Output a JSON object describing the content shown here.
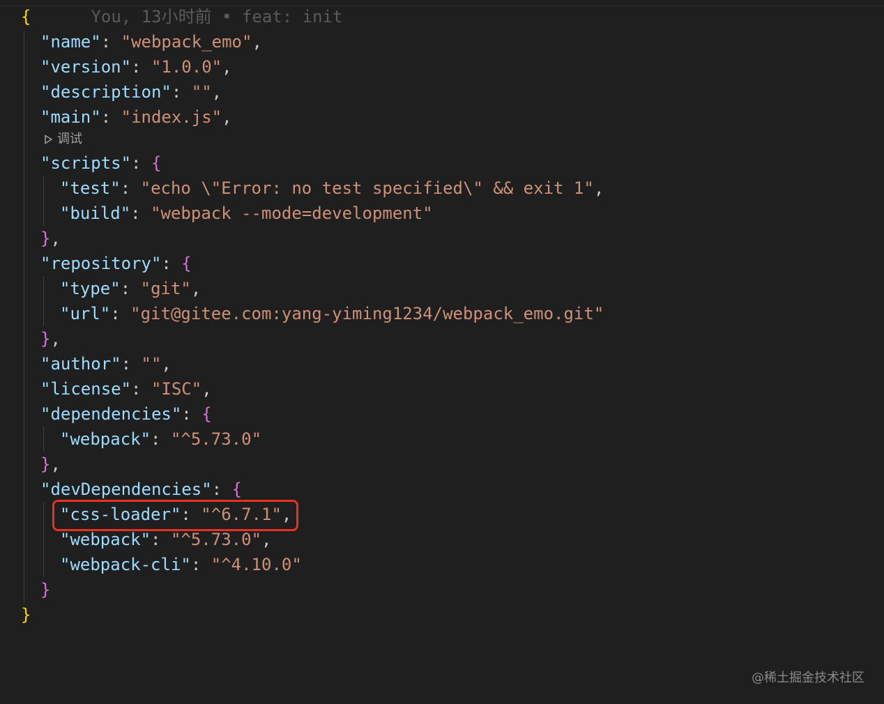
{
  "blame": "You, 13小时前 • feat: init",
  "codelens": {
    "icon": "play-triangle-icon",
    "label": "调试"
  },
  "json": {
    "name": "webpack_emo",
    "version": "1.0.0",
    "description": "",
    "main": "index.js",
    "scripts": {
      "test": "echo \\\"Error: no test specified\\\" && exit 1",
      "build": "webpack --mode=development"
    },
    "repository": {
      "type": "git",
      "url": "git@gitee.com:yang-yiming1234/webpack_emo.git"
    },
    "author": "",
    "license": "ISC",
    "dependencies": {
      "webpack": "^5.73.0"
    },
    "devDependencies": {
      "css-loader": "^6.7.1",
      "webpack": "^5.73.0",
      "webpack-cli": "^4.10.0"
    }
  },
  "highlight_color": "#e8321f",
  "watermark": "@稀土掘金技术社区"
}
